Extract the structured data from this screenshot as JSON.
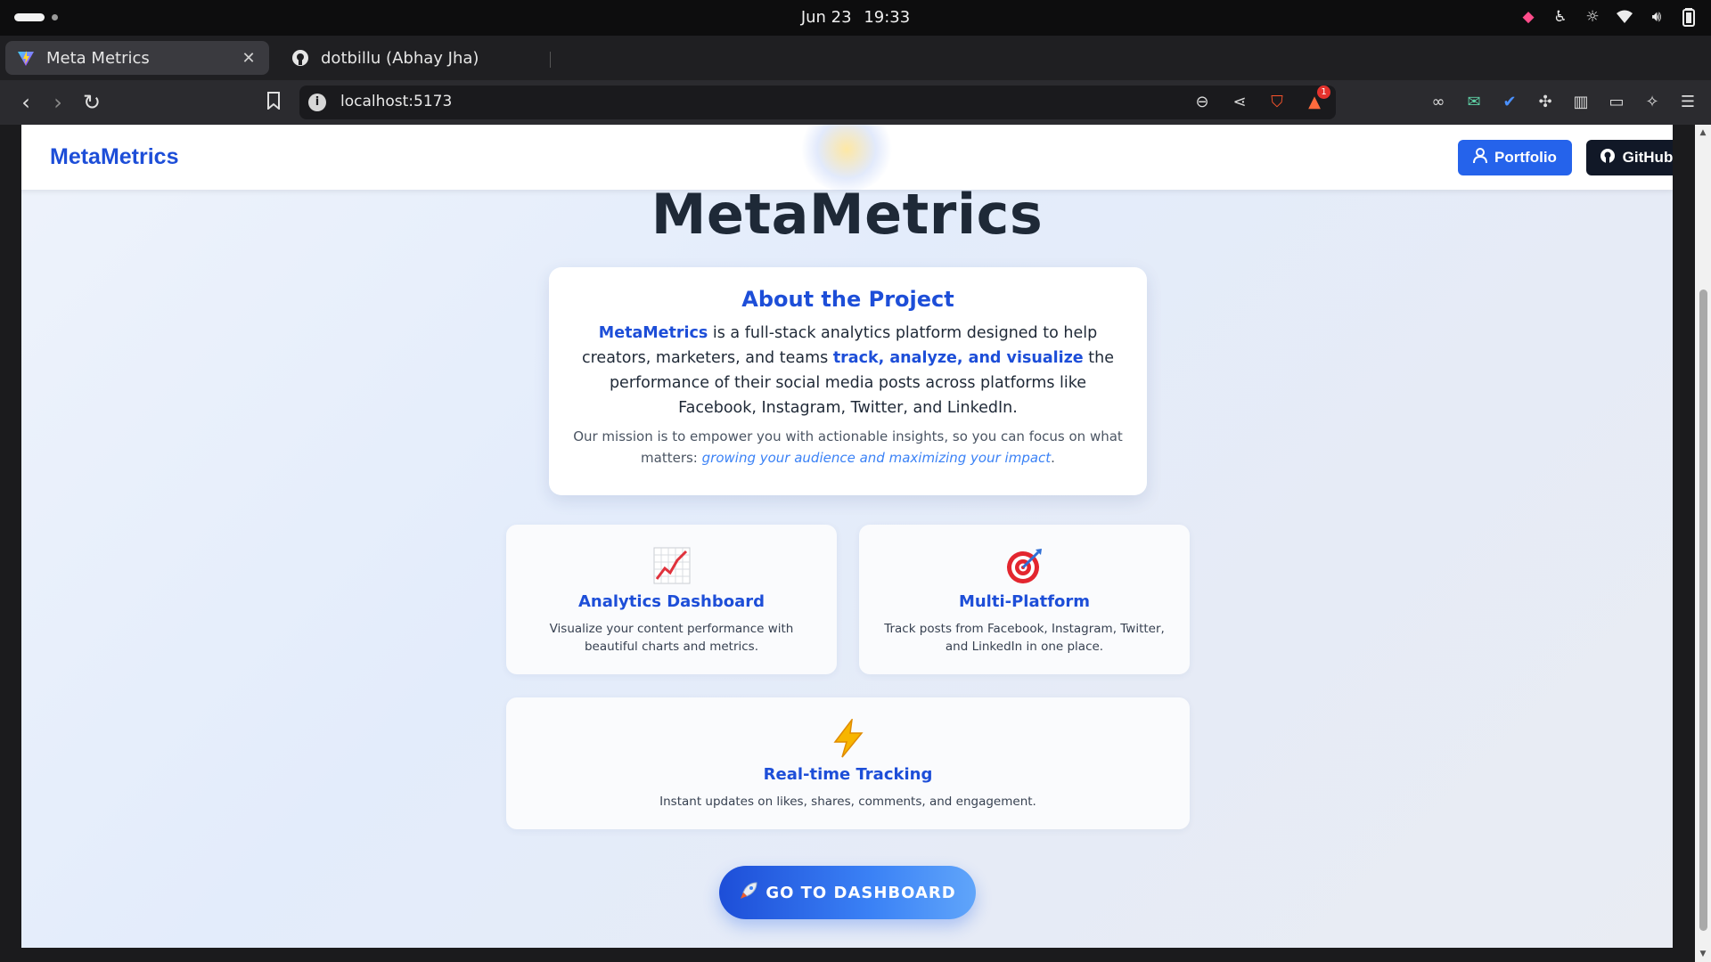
{
  "os": {
    "date": "Jun 23",
    "time": "19:33"
  },
  "browser": {
    "tabs": [
      {
        "title": "Meta Metrics",
        "active": true
      },
      {
        "title": "dotbillu (Abhay Jha)",
        "active": false
      }
    ],
    "url": "localhost:5173",
    "rewards_badge": "1"
  },
  "site": {
    "brand": "MetaMetrics",
    "nav": {
      "portfolio_label": "Portfolio",
      "github_label": "GitHub"
    },
    "hero_title": "MetaMetrics",
    "about": {
      "title": "About the Project",
      "brand_highlight": "MetaMetrics",
      "text_1": " is a full-stack analytics platform designed to help creators, marketers, and teams ",
      "highlight_2": "track, analyze, and visualize",
      "text_2": " the performance of their social media posts across platforms like Facebook, Instagram, Twitter, and LinkedIn.",
      "mission_text": "Our mission is to empower you with actionable insights, so you can focus on what matters: ",
      "mission_highlight": "growing your audience and maximizing your impact",
      "mission_end": "."
    },
    "features": [
      {
        "icon": "chart-increasing-icon",
        "title": "Analytics Dashboard",
        "desc": "Visualize your content performance with beautiful charts and metrics."
      },
      {
        "icon": "target-icon",
        "title": "Multi-Platform",
        "desc": "Track posts from Facebook, Instagram, Twitter, and LinkedIn in one place."
      },
      {
        "icon": "lightning-icon",
        "title": "Real-time Tracking",
        "desc": "Instant updates on likes, shares, comments, and engagement."
      }
    ],
    "cta_label": "GO TO DASHBOARD"
  },
  "colors": {
    "brand_blue": "#1d4ed8",
    "button_blue": "#2563eb",
    "github_dark": "#111827"
  }
}
